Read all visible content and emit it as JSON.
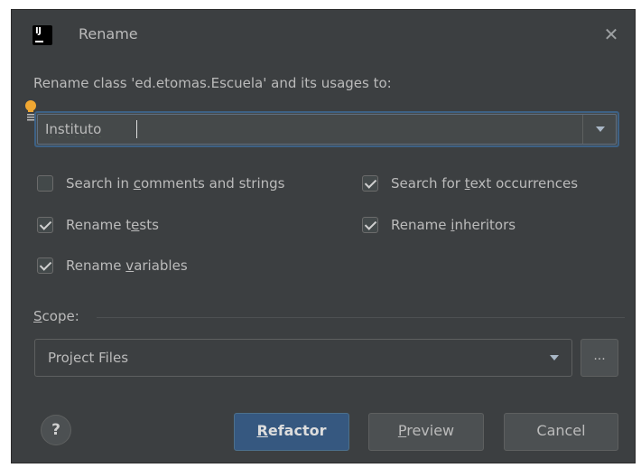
{
  "dialog": {
    "title": "Rename",
    "app_icon_text": "IJ"
  },
  "prompt": "Rename class 'ed.etomas.Escuela' and its usages to:",
  "name_input": {
    "value": "Instituto"
  },
  "options": {
    "search_comments": {
      "before": "Search in ",
      "mnemonic": "c",
      "after": "omments and strings",
      "checked": false
    },
    "search_text": {
      "before": "Search for ",
      "mnemonic": "t",
      "after": "ext occurrences",
      "checked": true
    },
    "rename_tests": {
      "before": "Rename t",
      "mnemonic": "e",
      "after": "sts",
      "checked": true
    },
    "rename_inheritors": {
      "before": "Rename ",
      "mnemonic": "i",
      "after": "nheritors",
      "checked": true
    },
    "rename_variables": {
      "before": "Rename ",
      "mnemonic": "v",
      "after": "ariables",
      "checked": true
    }
  },
  "scope": {
    "label_mnemonic": "S",
    "label_rest": "cope:",
    "value": "Project Files",
    "ellipsis": "..."
  },
  "buttons": {
    "help": "?",
    "refactor": {
      "mnemonic": "R",
      "rest": "efactor"
    },
    "preview": {
      "mnemonic": "P",
      "rest": "review"
    },
    "cancel": "Cancel"
  },
  "colors": {
    "dialog_bg": "#3c3f41",
    "focus_border": "#3d6185",
    "primary_button": "#365880",
    "bulb": "#f0a732"
  }
}
